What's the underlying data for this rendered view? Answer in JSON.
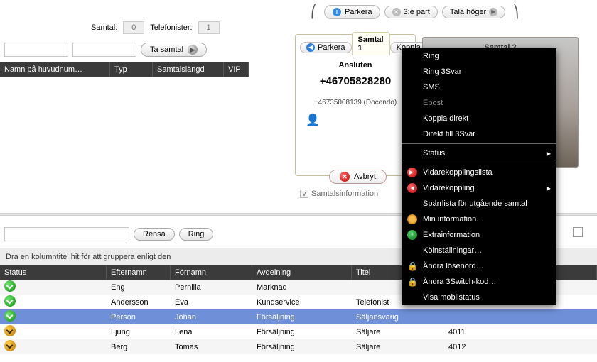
{
  "top": {
    "parkera": "Parkera",
    "tredje_part": "3:e part",
    "tala_hoger": "Tala höger"
  },
  "counters": {
    "samtal_label": "Samtal:",
    "samtal_value": "0",
    "telefonister_label": "Telefonister:",
    "telefonister_value": "1"
  },
  "take_call": {
    "btn_label": "Ta samtal"
  },
  "left_grid": {
    "col_name": "Namn på huvudnum…",
    "col_type": "Typ",
    "col_len": "Samtalslängd",
    "col_vip": "VIP"
  },
  "callcard": {
    "back_label": "Parkera",
    "tab_label": "Samtal 1",
    "koppla_label": "Koppla",
    "status": "Ansluten",
    "number": "+46705828280",
    "owner": "+46735008139 (Docendo)",
    "cancel": "Avbryt",
    "expander": "Samtalsinformation"
  },
  "call2": {
    "title": "Samtal 2"
  },
  "menu": {
    "ring": "Ring",
    "ring3svar": "Ring 3Svar",
    "sms": "SMS",
    "epost": "Epost",
    "koppla_direkt": "Koppla direkt",
    "direkt_3svar": "Direkt till 3Svar",
    "status": "Status",
    "vidarekopplingslista": "Vidarekopplingslista",
    "vidarekoppling": "Vidarekoppling",
    "sparrlista": "Spärrlista för utgående samtal",
    "min_info": "Min information…",
    "extrainfo": "Extrainformation",
    "koinst": "Köinställningar…",
    "andr_losen": "Ändra lösenord…",
    "andr_3switch": "Ändra 3Switch-kod…",
    "visa_mobil": "Visa mobilstatus"
  },
  "lower": {
    "rensa": "Rensa",
    "ring": "Ring",
    "group_hint": "Dra en kolumntitel hit för att gruppera enligt den",
    "cols": {
      "status": "Status",
      "efter": "Efternamn",
      "for": "Förnamn",
      "avd": "Avdelning",
      "titel": "Titel"
    },
    "rows": [
      {
        "status": "green",
        "efter": "Eng",
        "for": "Pernilla",
        "avd": "Marknad",
        "titel": "",
        "ext": ""
      },
      {
        "status": "green",
        "efter": "Andersson",
        "for": "Eva",
        "avd": "Kundservice",
        "titel": "Telefonist",
        "ext": ""
      },
      {
        "status": "green",
        "efter": "Person",
        "for": "Johan",
        "avd": "Försäljning",
        "titel": "Säljansvarig",
        "ext": "",
        "selected": true
      },
      {
        "status": "orange",
        "efter": "Ljung",
        "for": "Lena",
        "avd": "Försäljning",
        "titel": "Säljare",
        "ext": "4011"
      },
      {
        "status": "orange",
        "efter": "Berg",
        "for": "Tomas",
        "avd": "Försäljning",
        "titel": "Säljare",
        "ext": "4012"
      }
    ]
  }
}
